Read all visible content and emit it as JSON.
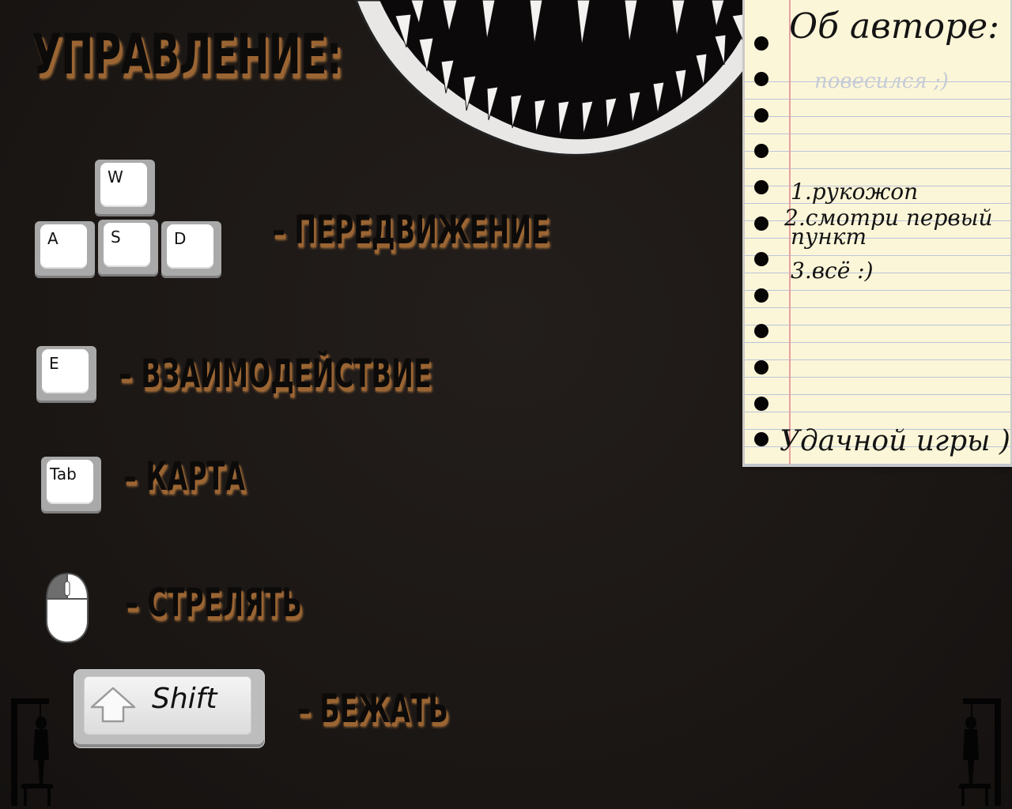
{
  "title": "УПРАВЛЕНИЕ:",
  "keys": {
    "w": "W",
    "a": "A",
    "s": "S",
    "d": "D",
    "e": "E",
    "tab": "Tab",
    "shift": "Shift"
  },
  "actions": {
    "move": "– ПЕРЕДВИЖЕНИЕ",
    "interact": "– ВЗАИМОДЕЙСТВИЕ",
    "map": "– КАРТА",
    "shoot": "– СТРЕЛЯТЬ",
    "run": "– БЕЖАТЬ"
  },
  "about": {
    "heading": "Об авторе:",
    "subtitle": "повесился ;)",
    "item1": "1.рукожоп",
    "item2_line1": "2.смотри первый",
    "item2_line2": "пункт",
    "item3": "3.всё :)",
    "farewell": "Удачной игры )"
  },
  "colors": {
    "background": "#1c1817",
    "label_shadow": "#9b6533",
    "paper": "#fcf6d8"
  },
  "icons": [
    "mouse-icon",
    "shift-arrow-icon",
    "mouth-illustration",
    "hanging-figure-left",
    "hanging-figure-right"
  ]
}
